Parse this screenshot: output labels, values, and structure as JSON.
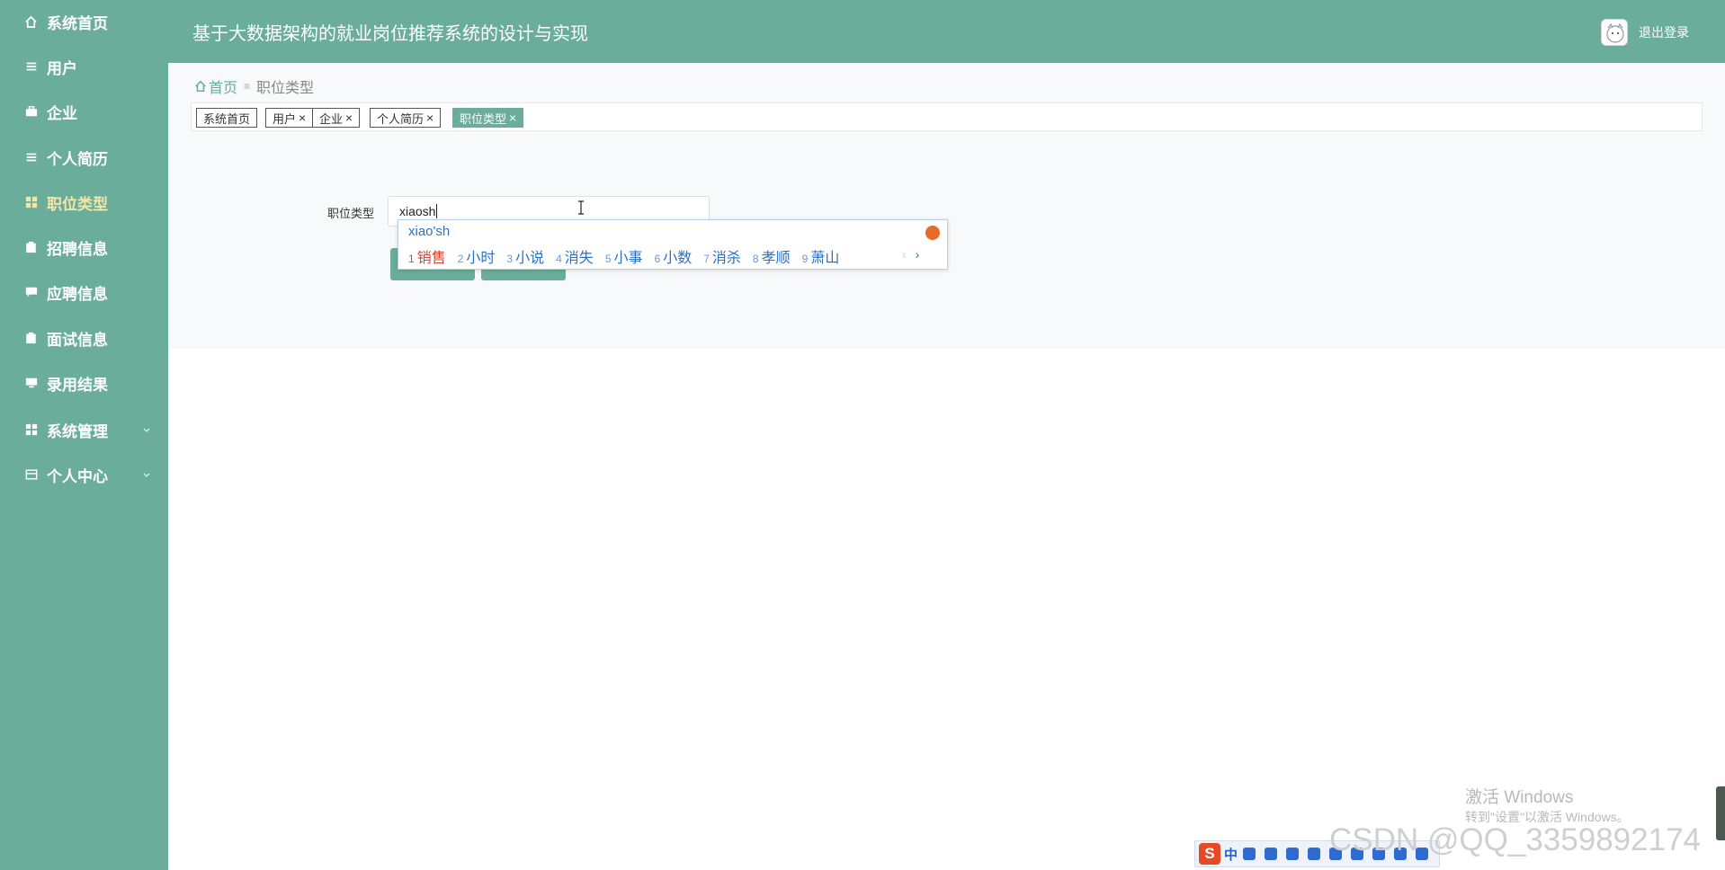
{
  "app": {
    "title": "基于大数据架构的就业岗位推荐系统的设计与实现",
    "logout_label": "退出登录"
  },
  "colors": {
    "primary": "#6aad9a",
    "active_menu_text": "#f3e6a8",
    "content_bg": "#f7f9fa",
    "ime_blue": "#2b72c4",
    "ime_red": "#e0412e"
  },
  "sidebar": {
    "items": [
      {
        "label": "系统首页",
        "icon": "home-icon"
      },
      {
        "label": "用户",
        "icon": "list-icon"
      },
      {
        "label": "企业",
        "icon": "briefcase-icon"
      },
      {
        "label": "个人简历",
        "icon": "list-icon"
      },
      {
        "label": "职位类型",
        "icon": "grid-icon",
        "active": true
      },
      {
        "label": "招聘信息",
        "icon": "clipboard-icon"
      },
      {
        "label": "应聘信息",
        "icon": "chat-icon"
      },
      {
        "label": "面试信息",
        "icon": "clipboard-icon"
      },
      {
        "label": "录用结果",
        "icon": "monitor-icon"
      },
      {
        "label": "系统管理",
        "icon": "grid-icon",
        "expandable": true
      },
      {
        "label": "个人中心",
        "icon": "id-card-icon",
        "expandable": true
      }
    ]
  },
  "breadcrumb": {
    "home": "首页",
    "current": "职位类型"
  },
  "tags": [
    {
      "label": "系统首页",
      "closable": false
    },
    {
      "label": "用户",
      "closable": true
    },
    {
      "label": "企业",
      "closable": true
    },
    {
      "label": "个人简历",
      "closable": true
    },
    {
      "label": "职位类型",
      "closable": true,
      "active": true
    }
  ],
  "form": {
    "label": "职位类型",
    "value": "xiaosh"
  },
  "ime": {
    "composition": "xiao'sh",
    "candidates": [
      {
        "num": "1",
        "text": "销售"
      },
      {
        "num": "2",
        "text": "小时"
      },
      {
        "num": "3",
        "text": "小说"
      },
      {
        "num": "4",
        "text": "消失"
      },
      {
        "num": "5",
        "text": "小事"
      },
      {
        "num": "6",
        "text": "小数"
      },
      {
        "num": "7",
        "text": "消杀"
      },
      {
        "num": "8",
        "text": "孝顺"
      },
      {
        "num": "9",
        "text": "萧山"
      }
    ],
    "nav_prev": "‹",
    "nav_next": "›"
  },
  "watermark": {
    "activate_title": "激活 Windows",
    "activate_sub": "转到\"设置\"以激活 Windows。",
    "csdn": "CSDN @QQ_3359892174"
  },
  "imebar": {
    "logo": "S",
    "lang": "中"
  }
}
